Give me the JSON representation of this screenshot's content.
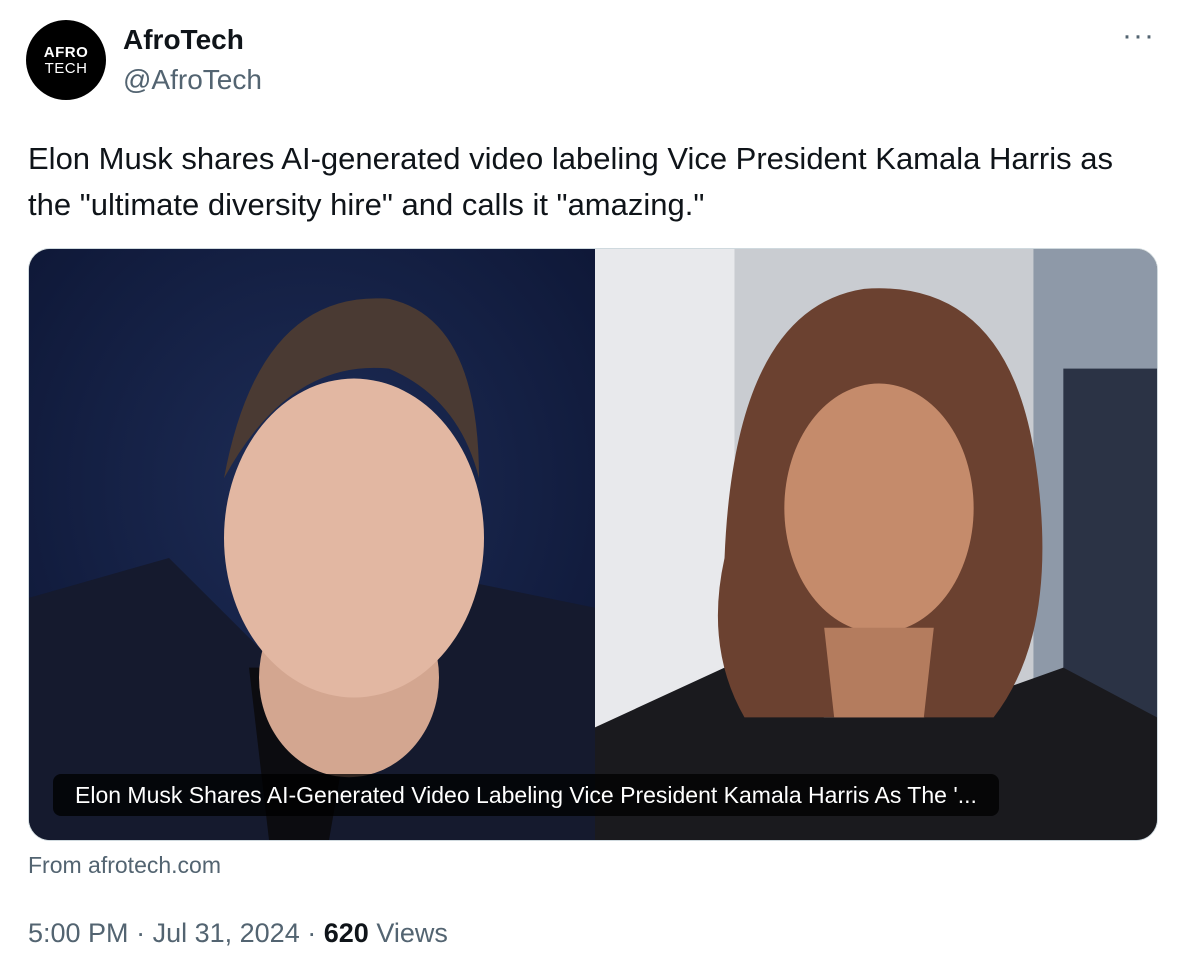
{
  "author": {
    "avatar_line1": "AFRO",
    "avatar_line2": "TECH",
    "name": "AfroTech",
    "handle": "@AfroTech"
  },
  "more_icon": "more-horizontal-icon",
  "tweet": {
    "text": "Elon Musk shares AI-generated video labeling Vice President Kamala Harris as the \"ultimate diversity hire\" and calls it \"amazing.\""
  },
  "card": {
    "caption": "Elon Musk Shares AI-Generated Video Labeling Vice President Kamala Harris As The '...",
    "source": "From afrotech.com"
  },
  "meta": {
    "time": "5:00 PM",
    "separator": "·",
    "date": "Jul 31, 2024",
    "views_count": "620",
    "views_label": "Views"
  },
  "colors": {
    "text_primary": "#0f1419",
    "text_secondary": "#536471",
    "border": "#cfd9de"
  }
}
